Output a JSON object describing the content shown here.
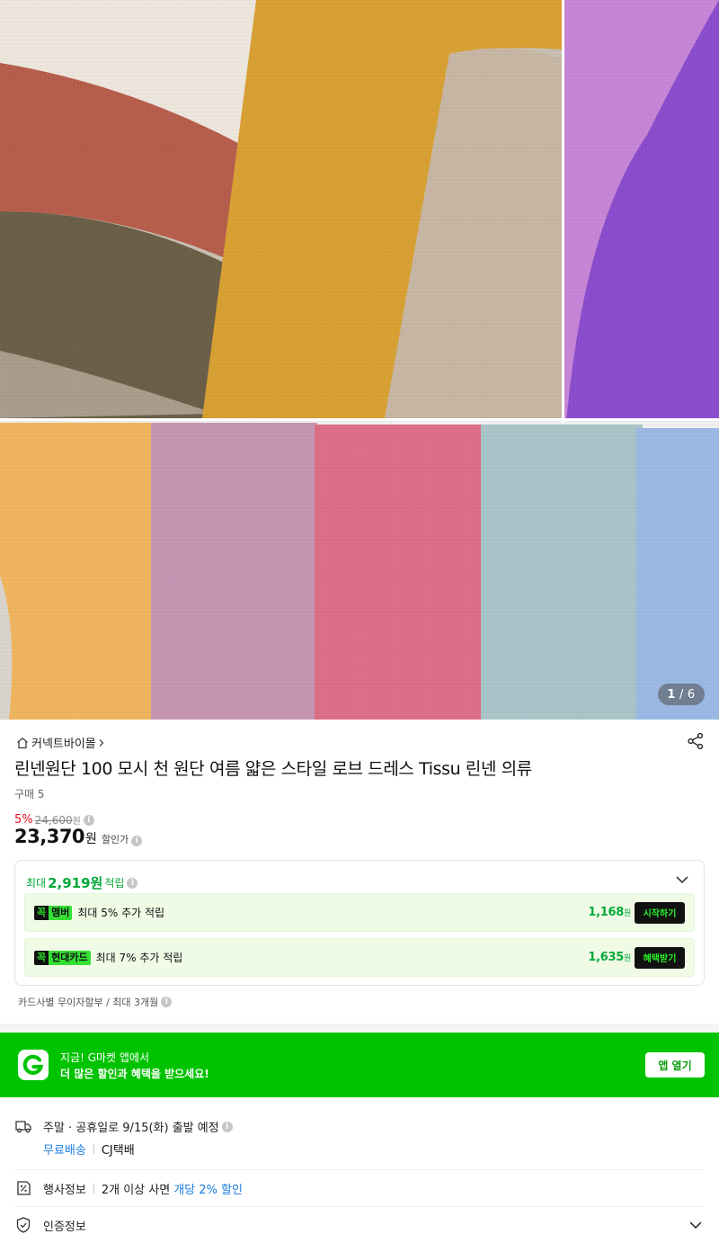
{
  "gallery": {
    "current": "1",
    "total": "6",
    "separator": "/"
  },
  "store": {
    "name": "커넥트바이몰"
  },
  "product": {
    "title": "린넨원단 100 모시 천 원단 여름 얇은 스타일 로브 드레스 Tissu 린넨 의류",
    "purchase_count": "구매 5",
    "discount_rate": "5%",
    "original_price": "24,600",
    "original_unit": "원",
    "price": "23,370",
    "price_unit": "원",
    "price_tag": "할인가"
  },
  "rewards": {
    "header_prefix": "최대",
    "header_amount": "2,919원",
    "header_suffix": "적립",
    "rows": [
      {
        "badge_k": "꼭",
        "badge_label": "멤버",
        "text": "최대 5% 추가 적립",
        "amount": "1,168",
        "unit": "원",
        "button": "시작하기"
      },
      {
        "badge_k": "꼭",
        "badge_label": "현대카드",
        "text": "최대 7% 추가 적립",
        "amount": "1,635",
        "unit": "원",
        "button": "혜택받기"
      }
    ]
  },
  "installment": "카드사별 무이자할부 / 최대 3개월",
  "app_banner": {
    "line1": "지금! G마켓 앱에서",
    "line2": "더 많은 할인과 혜택을 받으세요!",
    "button": "앱 열기"
  },
  "shipping": {
    "schedule": "주말 · 공휴일로 9/15(화) 출발 예정",
    "fee": "무료배송",
    "carrier": "CJ택배"
  },
  "event": {
    "label": "행사정보",
    "text": "2개 이상 사면",
    "highlight": "개당 2% 할인"
  },
  "certification": {
    "label": "인증정보"
  },
  "colors": {
    "accent_green": "#00c300",
    "reward_green": "#05a83a",
    "discount_red": "#e4111f",
    "link_blue": "#1a7ce0"
  },
  "icons": [
    "home-icon",
    "chevron-right-icon",
    "share-icon",
    "info-icon",
    "chevron-down-icon",
    "gmarket-g-logo",
    "truck-icon",
    "percent-tag-icon",
    "shield-check-icon"
  ]
}
